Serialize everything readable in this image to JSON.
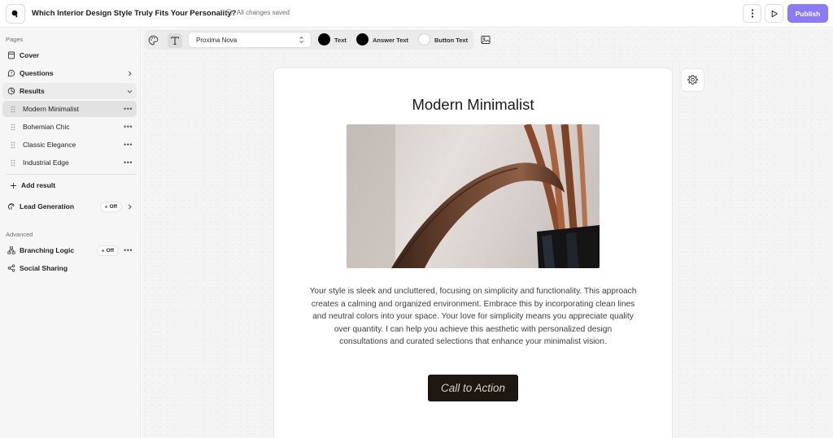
{
  "header": {
    "title": "Which Interior Design Style Truly Fits Your Personality?",
    "save_status": "All changes saved",
    "publish_label": "Publish"
  },
  "sidebar": {
    "pages_label": "Pages",
    "items": [
      {
        "label": "Cover",
        "icon": "document-icon"
      },
      {
        "label": "Questions",
        "icon": "question-icon"
      },
      {
        "label": "Results",
        "icon": "pie-chart-icon"
      }
    ],
    "results": [
      {
        "label": "Modern Minimalist"
      },
      {
        "label": "Bohemian Chic"
      },
      {
        "label": "Classic Elegance"
      },
      {
        "label": "Industrial Edge"
      }
    ],
    "add_result_label": "Add result",
    "lead_generation": {
      "label": "Lead Generation",
      "status": "Off"
    },
    "advanced_label": "Advanced",
    "branching_logic": {
      "label": "Branching Logic",
      "status": "Off"
    },
    "social_sharing": {
      "label": "Social Sharing"
    }
  },
  "toolbar": {
    "font": "Proxima Nova",
    "text_label": "Text",
    "answer_text_label": "Answer Text",
    "button_text_label": "Button Text",
    "colors": {
      "text": "#000000",
      "answer_text": "#000000",
      "button_text": "#ffffff"
    }
  },
  "result": {
    "title": "Modern Minimalist",
    "description": "Your style is sleek and uncluttered, focusing on simplicity and functionality. This approach creates a calming and organized environment. Embrace this by incorporating clean lines and neutral colors into your space. Your love for simplicity means you appreciate quality over quantity. I can help you achieve this aesthetic with personalized design consultations and curated selections that enhance your minimalist vision.",
    "cta_label": "Call to Action"
  },
  "colors": {
    "accent": "#8b7cf6",
    "cta_bg": "#1e1610"
  }
}
